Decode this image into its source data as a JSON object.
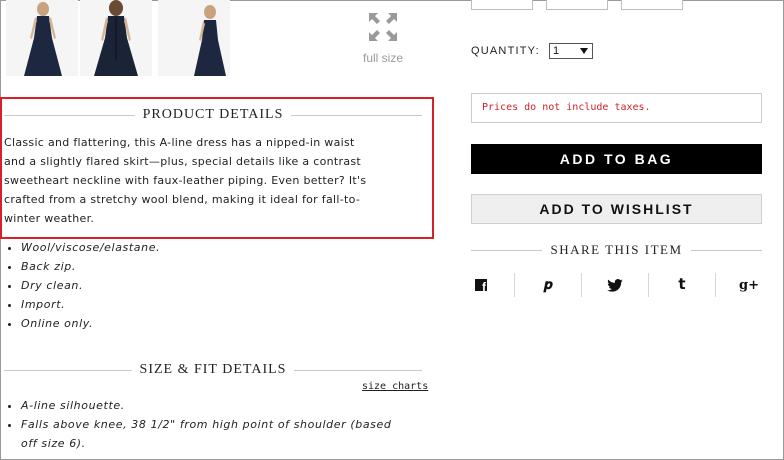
{
  "gallery": {
    "thumbnails": [
      "dress-front",
      "dress-back",
      "dress-side"
    ],
    "full_size_label": "full size"
  },
  "product_details": {
    "heading": "PRODUCT DETAILS",
    "description_lines": [
      "Classic and flattering, this A-line dress has a nipped-in waist",
      "and a slightly flared skirt—plus, special details like a contrast",
      "sweetheart neckline with faux-leather piping. Even better? It's",
      "crafted from a stretchy wool blend, making it ideal for fall-to-",
      "winter weather."
    ],
    "bullets": [
      "Wool/viscose/elastane.",
      "Back zip.",
      "Dry clean.",
      "Import.",
      "Online only."
    ]
  },
  "size_fit": {
    "heading": "SIZE & FIT DETAILS",
    "size_charts_link": "size charts",
    "bullets": [
      "A-line silhouette.",
      "Falls above knee, 38 1/2\" from high point of shoulder (based"
    ],
    "continuation": "off size 6)."
  },
  "purchase": {
    "quantity_label": "QUANTITY:",
    "quantity_value": "1",
    "tax_notice": "Prices do not include taxes.",
    "add_to_bag": "ADD TO BAG",
    "add_to_wishlist": "ADD TO WISHLIST"
  },
  "share": {
    "heading": "SHARE THIS ITEM",
    "networks": [
      "facebook",
      "pinterest",
      "twitter",
      "tumblr",
      "google-plus"
    ],
    "glyphs": {
      "pinterest": "𝒑",
      "twitter": "🐦",
      "tumblr": "t",
      "google_plus": "g+"
    }
  },
  "colors": {
    "accent_red": "#d7202b",
    "tax_text": "#d01f2a",
    "button_black": "#000000"
  }
}
